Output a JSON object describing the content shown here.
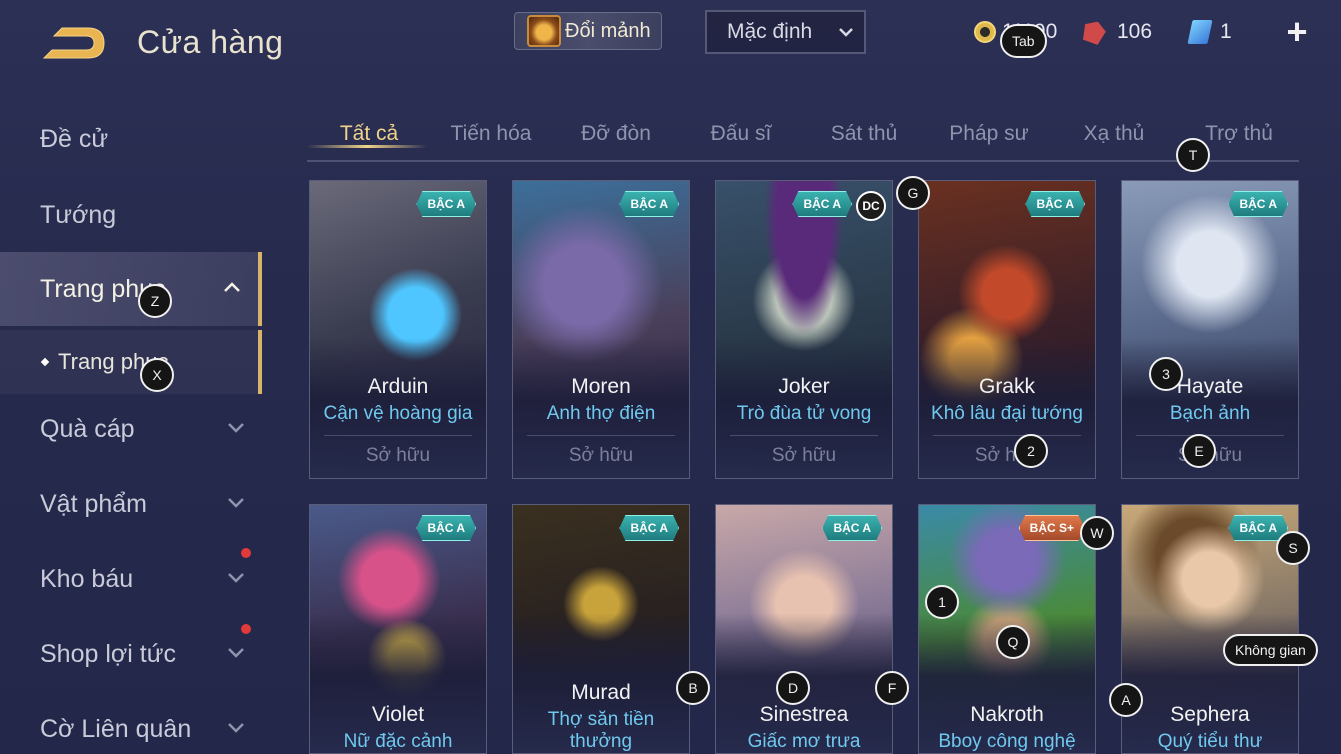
{
  "header": {
    "title": "Cửa hàng",
    "exchange_label": "Đổi mảnh",
    "sort_value": "Mặc định",
    "coins": "11190",
    "gems": "106",
    "tickets": "1",
    "plus": "+"
  },
  "sidebar": {
    "items": [
      {
        "label": "Đề cử"
      },
      {
        "label": "Tướng"
      },
      {
        "label": "Trang phục"
      },
      {
        "label": "Quà cáp"
      },
      {
        "label": "Vật phẩm"
      },
      {
        "label": "Kho báu"
      },
      {
        "label": "Shop lợi tức"
      },
      {
        "label": "Cờ Liên quân"
      }
    ],
    "sub_item": "Trang phục"
  },
  "tabs": [
    "Tất cả",
    "Tiến hóa",
    "Đỡ đòn",
    "Đấu sĩ",
    "Sát thủ",
    "Pháp sư",
    "Xạ thủ",
    "Trợ thủ"
  ],
  "cards": [
    {
      "tier": "BẬC A",
      "hero": "Arduin",
      "skin": "Cận vệ hoàng gia",
      "status": "Sở hữu"
    },
    {
      "tier": "BẬC A",
      "hero": "Moren",
      "skin": "Anh thợ điện",
      "status": "Sở hữu"
    },
    {
      "tier": "BẬC A",
      "hero": "Joker",
      "skin": "Trò đùa tử vong",
      "status": "Sở hữu",
      "badge": "DC"
    },
    {
      "tier": "BẬC A",
      "hero": "Grakk",
      "skin": "Khô lâu đại tướng",
      "status": "Sở hữu"
    },
    {
      "tier": "BẬC A",
      "hero": "Hayate",
      "skin": "Bạch ảnh",
      "status": "Sở hữu"
    },
    {
      "tier": "BẬC A",
      "hero": "Violet",
      "skin": "Nữ đặc cảnh"
    },
    {
      "tier": "BẬC A",
      "hero": "Murad",
      "skin": "Thợ săn tiền thưởng"
    },
    {
      "tier": "BẬC A",
      "hero": "Sinestrea",
      "skin": "Giấc mơ trưa"
    },
    {
      "tier": "BẬC S+",
      "hero": "Nakroth",
      "skin": "Bboy công nghệ"
    },
    {
      "tier": "BẬC A",
      "hero": "Sephera",
      "skin": "Quý tiểu thư"
    }
  ],
  "hints": [
    "Tab",
    "Z",
    "X",
    "T",
    "G",
    "3",
    "2",
    "E",
    "W",
    "S",
    "1",
    "Q",
    "Không gian",
    "B",
    "D",
    "F",
    "A"
  ],
  "colors": {
    "accent_gold": "#f0d38a",
    "skin_name": "#6fc9ef",
    "tier_teal": "#2a9a99",
    "tier_splus": "#d06a3f"
  }
}
